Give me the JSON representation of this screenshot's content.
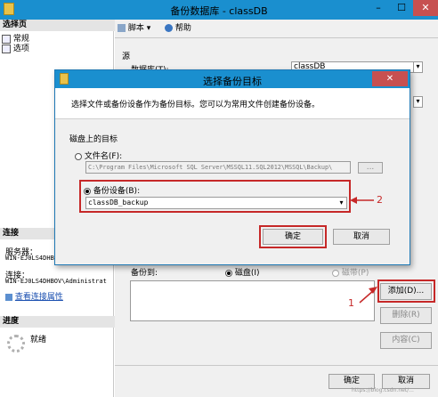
{
  "window": {
    "title": "备份数据库 - classDB",
    "minimize": "–",
    "maximize": "☐",
    "close": "✕"
  },
  "left_pane": {
    "select_page_header": "选择页",
    "pages": [
      {
        "label": "常规"
      },
      {
        "label": "选项"
      }
    ],
    "connection_header": "连接",
    "server_label": "服务器：",
    "server_value": "WIN-EJ0LS4DHB",
    "connection_label": "连接：",
    "connection_value": "WIN-EJ0LS4DHBOV\\Administrat",
    "view_connection_link": "查看连接属性",
    "progress_header": "进度",
    "progress_status": "就绪"
  },
  "toolbar": {
    "script_label": "脚本",
    "help_label": "帮助"
  },
  "main": {
    "source_section": "源",
    "database_label": "数据库(T):",
    "database_value": "classDB",
    "backup_to_label": "备份到:",
    "disk_option": "磁盘(I)",
    "tape_option": "磁带(P)",
    "add_button": "添加(D)...",
    "remove_button": "删除(R)",
    "contents_button": "内容(C)",
    "ok_button": "确定",
    "cancel_button": "取消"
  },
  "dialog": {
    "title": "选择备份目标",
    "description": "选择文件或备份设备作为备份目标。您可以为常用文件创建备份设备。",
    "disk_target_label": "磁盘上的目标",
    "file_name_option": "文件名(F):",
    "file_name_value": "C:\\Program Files\\Microsoft SQL Server\\MSSQL11.SQL2012\\MSSQL\\Backup\\",
    "browse_button": "...",
    "backup_device_option": "备份设备(B):",
    "backup_device_value": "classDB_backup",
    "ok_button": "确定",
    "cancel_button": "取消",
    "close": "✕"
  },
  "annotations": {
    "marker_1": "1",
    "marker_2": "2"
  },
  "watermark": "https://blog.csdn.net/..."
}
